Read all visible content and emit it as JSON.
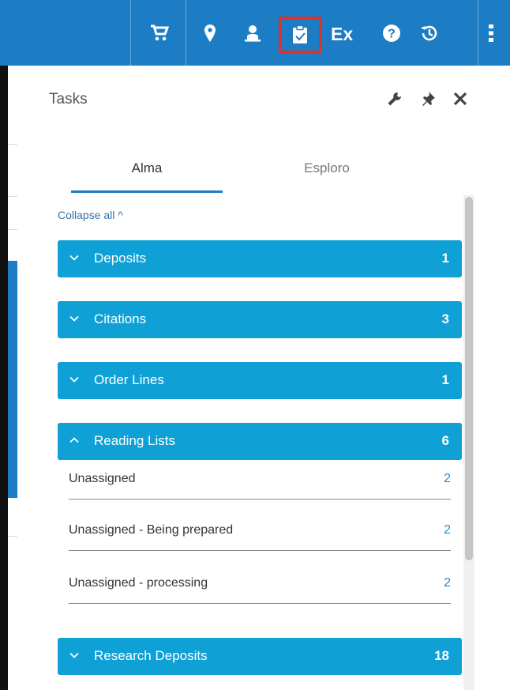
{
  "colors": {
    "header": "#1c7cc4",
    "group": "#0fa0d6",
    "highlight": "#e0302b",
    "count_link": "#1c8fd4"
  },
  "header": {
    "icons": [
      "cart-icon",
      "location-pin-icon",
      "user-icon",
      "tasks-clipboard-icon",
      "ex-icon",
      "help-icon",
      "history-icon",
      "more-vertical-icon"
    ],
    "active_icon": "tasks-clipboard-icon"
  },
  "panel": {
    "title": "Tasks",
    "tool_icons": [
      "wrench-icon",
      "pin-icon",
      "close-icon"
    ],
    "tabs": [
      {
        "label": "Alma",
        "active": true
      },
      {
        "label": "Esploro",
        "active": false
      }
    ],
    "collapse_label": "Collapse all ^",
    "groups": [
      {
        "title": "Deposits",
        "count": "1",
        "expanded": false
      },
      {
        "title": "Citations",
        "count": "3",
        "expanded": false
      },
      {
        "title": "Order Lines",
        "count": "1",
        "expanded": false
      },
      {
        "title": "Reading Lists",
        "count": "6",
        "expanded": true,
        "items": [
          {
            "label": "Unassigned",
            "count": "2"
          },
          {
            "label": "Unassigned - Being prepared",
            "count": "2"
          },
          {
            "label": "Unassigned - processing",
            "count": "2"
          }
        ]
      },
      {
        "title": "Research Deposits",
        "count": "18",
        "expanded": false
      }
    ]
  }
}
